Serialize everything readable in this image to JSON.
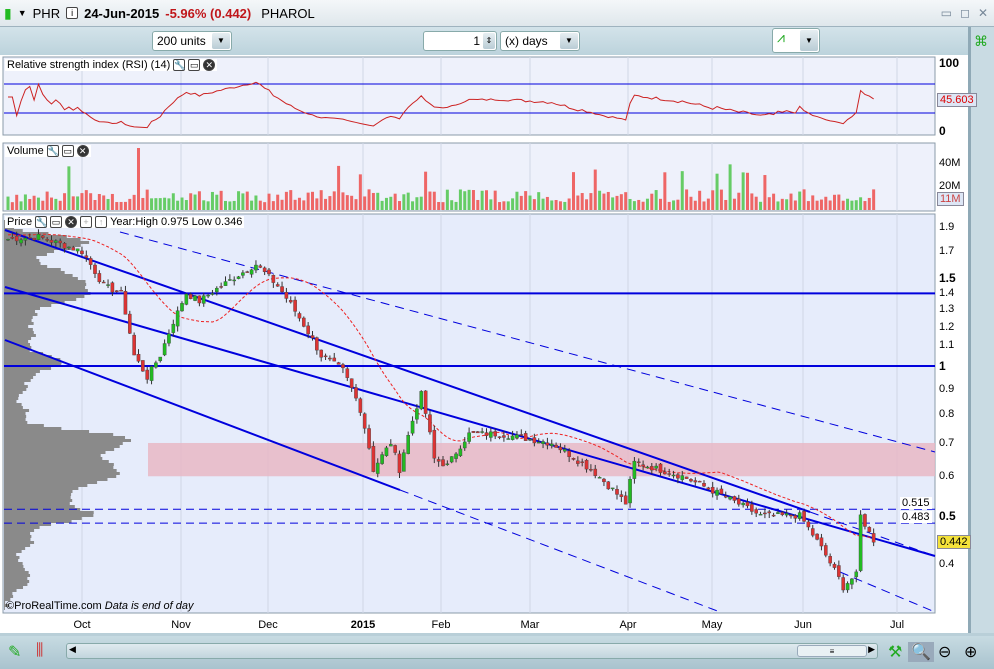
{
  "header": {
    "symbol": "PHR",
    "date": "24-Jun-2015",
    "change": "-5.96% (0.442)",
    "name": "PHAROL"
  },
  "toolbar": {
    "units": "200 units",
    "period_value": "1",
    "period_unit": "(x) days"
  },
  "rsi": {
    "label": "Relative strength index (RSI) (14)",
    "ticks": [
      "100",
      "0"
    ],
    "value": "45.603",
    "levels": [
      70,
      30
    ]
  },
  "volume": {
    "label": "Volume",
    "ticks": [
      "40M",
      "20M"
    ],
    "value": "11M"
  },
  "price": {
    "label": "Price",
    "yearinfo": "Year:High 0.975 Low 0.346",
    "last": "0.442",
    "line_labels": [
      "0.515",
      "0.483"
    ],
    "ticks": [
      "1.9",
      "1.7",
      "1.5",
      "1.4",
      "1.3",
      "1.2",
      "1.1",
      "1",
      "0.9",
      "0.8",
      "0.7",
      "0.6",
      "0.5",
      "0.4"
    ],
    "copyright": "©ProRealTime.com",
    "note": "Data is end of day"
  },
  "xaxis": [
    "Oct",
    "Nov",
    "Dec",
    "2015",
    "Feb",
    "Mar",
    "Apr",
    "May",
    "Jun",
    "Jul"
  ],
  "chart_data": {
    "type": "candlestick",
    "title": "PHR PHAROL",
    "scale": "log",
    "ylim": [
      0.33,
      1.95
    ],
    "anchors_day_price": [
      [
        0,
        1.8
      ],
      [
        7,
        1.82
      ],
      [
        17,
        1.7
      ],
      [
        22,
        1.45
      ],
      [
        26,
        1.4
      ],
      [
        29,
        1.05
      ],
      [
        32,
        0.95
      ],
      [
        35,
        1.05
      ],
      [
        41,
        1.4
      ],
      [
        44,
        1.35
      ],
      [
        48,
        1.43
      ],
      [
        57,
        1.6
      ],
      [
        62,
        1.45
      ],
      [
        67,
        1.25
      ],
      [
        72,
        1.05
      ],
      [
        77,
        0.98
      ],
      [
        81,
        0.82
      ],
      [
        84,
        0.62
      ],
      [
        88,
        0.7
      ],
      [
        90,
        0.62
      ],
      [
        95,
        0.88
      ],
      [
        98,
        0.65
      ],
      [
        101,
        0.63
      ],
      [
        106,
        0.73
      ],
      [
        113,
        0.73
      ],
      [
        125,
        0.7
      ],
      [
        134,
        0.62
      ],
      [
        142,
        0.53
      ],
      [
        144,
        0.64
      ],
      [
        155,
        0.6
      ],
      [
        164,
        0.55
      ],
      [
        173,
        0.5
      ],
      [
        182,
        0.5
      ],
      [
        187,
        0.43
      ],
      [
        192,
        0.36
      ],
      [
        195,
        0.38
      ],
      [
        196,
        0.5
      ],
      [
        199,
        0.442
      ]
    ],
    "hlines": [
      1.4,
      1.0,
      0.515,
      0.483
    ],
    "zone": [
      0.6,
      0.7
    ]
  },
  "colors": {
    "up": "#22bb22",
    "down": "#dd3333",
    "line": "#0000dd"
  }
}
